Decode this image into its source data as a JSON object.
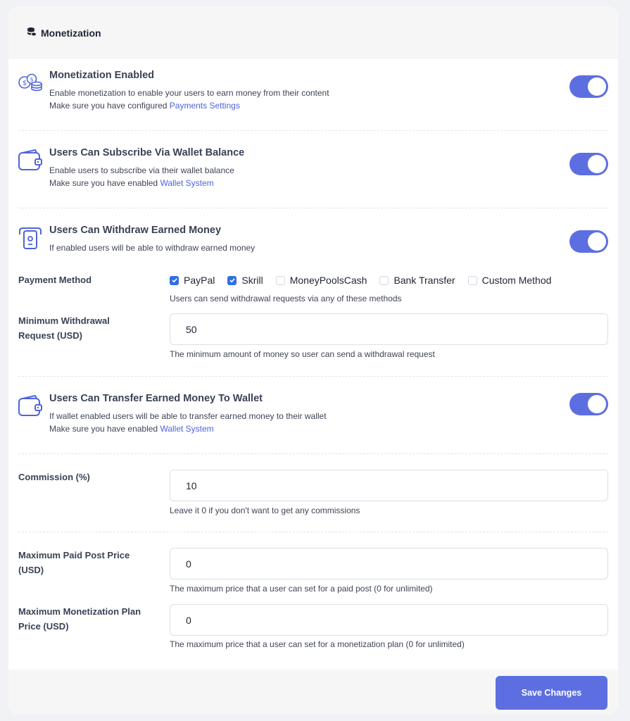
{
  "header": {
    "title": "Monetization"
  },
  "sections": {
    "monetization": {
      "title": "Monetization Enabled",
      "desc1": "Enable monetization to enable your users to earn money from their content",
      "desc2_prefix": "Make sure you have configured ",
      "desc2_link": "Payments Settings",
      "enabled": true
    },
    "wallet_subscribe": {
      "title": "Users Can Subscribe Via Wallet Balance",
      "desc1": "Enable users to subscribe via their wallet balance",
      "desc2_prefix": "Make sure you have enabled ",
      "desc2_link": "Wallet System",
      "enabled": true
    },
    "withdraw": {
      "title": "Users Can Withdraw Earned Money",
      "desc1": "If enabled users will be able to withdraw earned money",
      "enabled": true
    },
    "transfer": {
      "title": "Users Can Transfer Earned Money To Wallet",
      "desc1": "If wallet enabled users will be able to transfer earned money to their wallet",
      "desc2_prefix": "Make sure you have enabled ",
      "desc2_link": "Wallet System",
      "enabled": true
    }
  },
  "payment_method": {
    "label": "Payment Method",
    "options": [
      {
        "label": "PayPal",
        "checked": true
      },
      {
        "label": "Skrill",
        "checked": true
      },
      {
        "label": "MoneyPoolsCash",
        "checked": false
      },
      {
        "label": "Bank Transfer",
        "checked": false
      },
      {
        "label": "Custom Method",
        "checked": false
      }
    ],
    "help": "Users can send withdrawal requests via any of these methods"
  },
  "min_withdrawal": {
    "label": "Minimum Withdrawal Request (USD)",
    "value": "50",
    "help": "The minimum amount of money so user can send a withdrawal request"
  },
  "commission": {
    "label": "Commission (%)",
    "value": "10",
    "help": "Leave it 0 if you don't want to get any commissions"
  },
  "max_post_price": {
    "label": "Maximum Paid Post Price (USD)",
    "value": "0",
    "help": "The maximum price that a user can set for a paid post (0 for unlimited)"
  },
  "max_plan_price": {
    "label": "Maximum Monetization Plan Price (USD)",
    "value": "0",
    "help": "The maximum price that a user can set for a monetization plan (0 for unlimited)"
  },
  "footer": {
    "save_label": "Save Changes"
  },
  "colors": {
    "accent": "#5d6fe0",
    "link": "#4c62e3",
    "checkbox": "#2d6fe6"
  },
  "icons": {
    "header": "coins-stack-icon",
    "monetization": "coins-icon",
    "wallet": "wallet-icon",
    "withdraw": "atm-withdraw-icon"
  }
}
